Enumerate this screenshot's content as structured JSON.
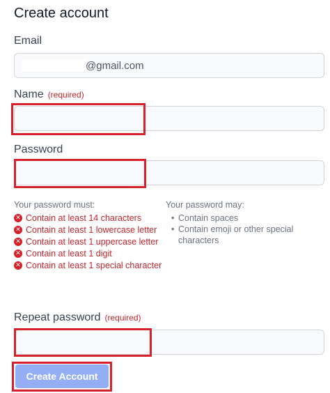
{
  "form": {
    "title": "Create account",
    "email": {
      "label": "Email",
      "suffix": "@gmail.com"
    },
    "name": {
      "label": "Name",
      "required": "(required)"
    },
    "password": {
      "label": "Password"
    },
    "repeat": {
      "label": "Repeat password",
      "required": "(required)"
    }
  },
  "rules": {
    "must_title": "Your password must:",
    "must": [
      "Contain at least 14 characters",
      "Contain at least 1 lowercase letter",
      "Contain at least 1 uppercase letter",
      "Contain at least 1 digit",
      "Contain at least 1 special character"
    ],
    "may_title": "Your password may:",
    "may": [
      "Contain spaces",
      "Contain emoji or other special characters"
    ]
  },
  "button": {
    "label": "Create Account"
  },
  "colors": {
    "error": "#c0262d",
    "highlight": "#d6202a",
    "button": "#93aef5"
  }
}
